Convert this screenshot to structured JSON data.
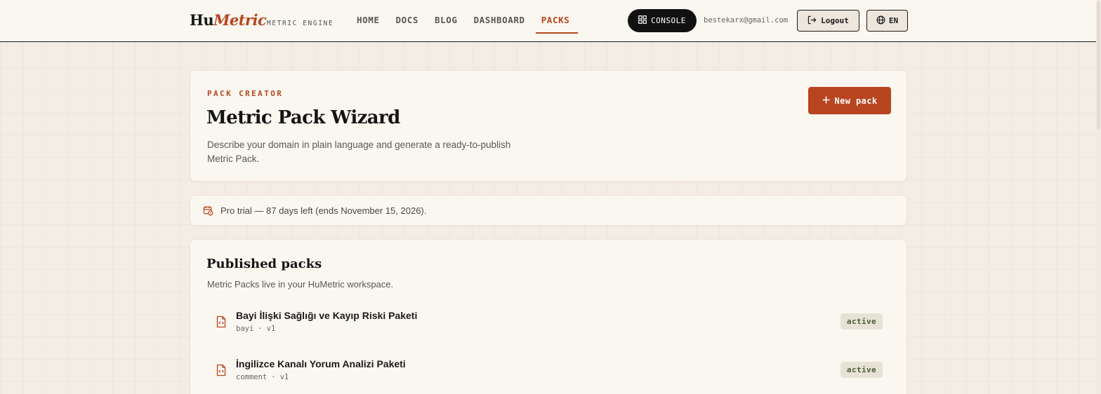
{
  "header": {
    "logo_hu": "Hu",
    "logo_metric": "Metric",
    "logo_sub": "METRIC ENGINE",
    "nav": [
      {
        "label": "HOME"
      },
      {
        "label": "DOCS"
      },
      {
        "label": "BLOG"
      },
      {
        "label": "DASHBOARD"
      },
      {
        "label": "PACKS",
        "active": true
      }
    ],
    "console_label": "CONSOLE",
    "email": "bestekarx@gmail.com",
    "logout_label": "Logout",
    "lang_label": "EN"
  },
  "hero": {
    "eyebrow": "PACK CREATOR",
    "title": "Metric Pack Wizard",
    "description": "Describe your domain in plain language and generate a ready-to-publish Metric Pack.",
    "new_pack_label": "New pack"
  },
  "trial": {
    "text": "Pro trial — 87 days left (ends November 15, 2026)."
  },
  "packs": {
    "title": "Published packs",
    "description": "Metric Packs live in your HuMetric workspace.",
    "items": [
      {
        "name": "Bayi İlişki Sağlığı ve Kayıp Riski Paketi",
        "slug": "bayi",
        "version": "v1",
        "status": "active"
      },
      {
        "name": "İngilizce Kanalı Yorum Analizi Paketi",
        "slug": "comment",
        "version": "v1",
        "status": "active"
      }
    ]
  },
  "colors": {
    "accent": "#b8451f",
    "background": "#f3ede6",
    "card": "#faf7f0",
    "dark": "#111111"
  }
}
